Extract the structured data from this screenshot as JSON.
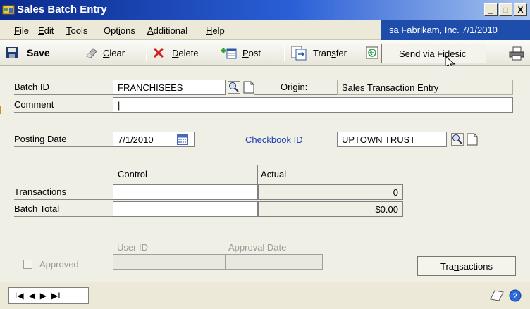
{
  "window": {
    "title": "Sales Batch Entry",
    "min_label": "_",
    "max_label": "□",
    "close_label": "X"
  },
  "menu": {
    "file": {
      "pre": "",
      "ul": "F",
      "post": "ile"
    },
    "edit": {
      "pre": "",
      "ul": "E",
      "post": "dit"
    },
    "tools": {
      "pre": "",
      "ul": "T",
      "post": "ools"
    },
    "options": {
      "pre": "Opt",
      "ul": "i",
      "post": "ons"
    },
    "additional": {
      "pre": "",
      "ul": "A",
      "post": "dditional"
    },
    "help": {
      "pre": "",
      "ul": "H",
      "post": "elp"
    }
  },
  "company": "sa  Fabrikam, Inc.  7/1/2010",
  "toolbar": {
    "save": "Save",
    "clear": {
      "pre": "",
      "ul": "C",
      "post": "lear"
    },
    "delete": {
      "pre": "",
      "ul": "D",
      "post": "elete"
    },
    "post": {
      "pre": "",
      "ul": "P",
      "post": "ost"
    },
    "transfer": {
      "pre": "Tran",
      "ul": "s",
      "post": "fer"
    },
    "fidesic": {
      "pre": "Send ",
      "ul": "v",
      "post": "ia Fidesic"
    }
  },
  "form": {
    "batch_id_label": "Batch ID",
    "batch_id_value": "FRANCHISEES",
    "origin_label": "Origin:",
    "origin_value": "Sales Transaction Entry",
    "comment_label": "Comment",
    "comment_value": "|",
    "posting_date_label": "Posting Date",
    "posting_date_value": "7/1/2010",
    "checkbook_label": "Checkbook ID",
    "checkbook_value": "UPTOWN TRUST",
    "control_header": "Control",
    "actual_header": "Actual",
    "transactions_label": "Transactions",
    "transactions_actual": "0",
    "batch_total_label": "Batch Total",
    "batch_total_actual": "$0.00",
    "user_id_label": "User ID",
    "approval_date_label": "Approval Date",
    "approved_label": "Approved",
    "transactions_button": {
      "pre": "Tra",
      "ul": "n",
      "post": "sactions"
    }
  },
  "statusbar": {
    "first": "I◀",
    "prev": "◀",
    "next": "▶",
    "last": "▶I"
  }
}
